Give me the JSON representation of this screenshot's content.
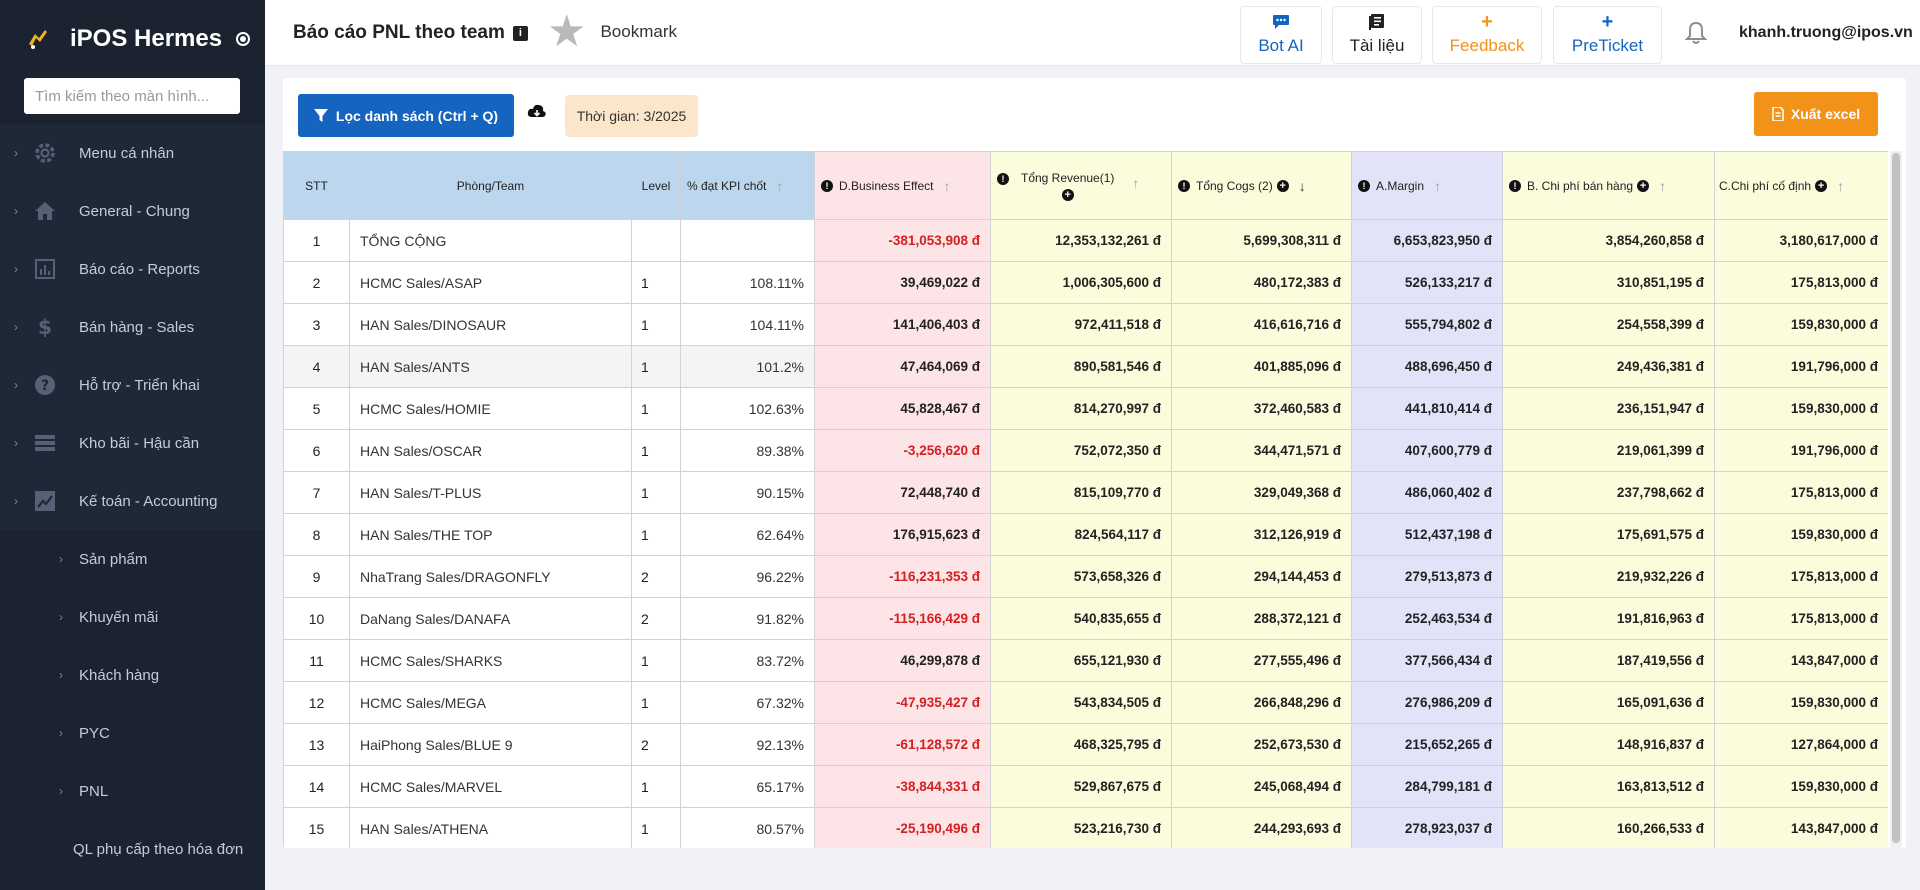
{
  "sidebar": {
    "app_name": "iPOS Hermes",
    "search_placeholder": "Tìm kiếm theo màn hình...",
    "menu": [
      {
        "label": "Menu cá nhân",
        "icon": "gear-icon"
      },
      {
        "label": "General - Chung",
        "icon": "home-icon"
      },
      {
        "label": "Báo cáo - Reports",
        "icon": "bar-chart-icon"
      },
      {
        "label": "Bán hàng - Sales",
        "icon": "dollar-icon"
      },
      {
        "label": "Hỗ trợ - Triển khai",
        "icon": "question-icon"
      },
      {
        "label": "Kho bãi - Hậu cần",
        "icon": "server-icon"
      },
      {
        "label": "Kế toán - Accounting",
        "icon": "chart-box-icon"
      }
    ],
    "submenu": [
      "Sản phẩm",
      "Khuyến mãi",
      "Khách hàng",
      "PYC",
      "PNL"
    ],
    "extra_item": "QL phụ cấp theo hóa đơn"
  },
  "header": {
    "title": "Báo cáo PNL theo team",
    "info_label": "i",
    "bookmark_label": "Bookmark",
    "buttons": {
      "bot_ai": "Bot AI",
      "tai_lieu": "Tài liệu",
      "feedback": "Feedback",
      "preticket": "PreTicket"
    },
    "user_email": "khanh.truong@ipos.vn"
  },
  "toolbar": {
    "filter_label": "Lọc danh sách (Ctrl + Q)",
    "time_label": "Thời gian: 3/2025",
    "export_label": "Xuất excel"
  },
  "table": {
    "headers": {
      "stt": "STT",
      "team": "Phòng/Team",
      "level": "Level",
      "kpi": "% đạt KPI chốt",
      "be": "D.Business Effect",
      "rev": "Tổng Revenue(1)",
      "cogs": "Tổng Cogs (2)",
      "am": "A.Margin",
      "bcp": "B. Chi phí bán hàng",
      "ccp": "C.Chi phí cố định"
    },
    "rows": [
      {
        "stt": "1",
        "team": "TỔNG CỘNG",
        "level": "",
        "kpi": "",
        "be": "-381,053,908 đ",
        "rev": "12,353,132,261 đ",
        "cogs": "5,699,308,311 đ",
        "am": "6,653,823,950 đ",
        "bcp": "3,854,260,858 đ",
        "ccp": "3,180,617,000 đ",
        "neg": true
      },
      {
        "stt": "2",
        "team": "HCMC Sales/ASAP",
        "level": "1",
        "kpi": "108.11%",
        "be": "39,469,022 đ",
        "rev": "1,006,305,600 đ",
        "cogs": "480,172,383 đ",
        "am": "526,133,217 đ",
        "bcp": "310,851,195 đ",
        "ccp": "175,813,000 đ",
        "neg": false
      },
      {
        "stt": "3",
        "team": "HAN Sales/DINOSAUR",
        "level": "1",
        "kpi": "104.11%",
        "be": "141,406,403 đ",
        "rev": "972,411,518 đ",
        "cogs": "416,616,716 đ",
        "am": "555,794,802 đ",
        "bcp": "254,558,399 đ",
        "ccp": "159,830,000 đ",
        "neg": false
      },
      {
        "stt": "4",
        "team": "HAN Sales/ANTS",
        "level": "1",
        "kpi": "101.2%",
        "be": "47,464,069 đ",
        "rev": "890,581,546 đ",
        "cogs": "401,885,096 đ",
        "am": "488,696,450 đ",
        "bcp": "249,436,381 đ",
        "ccp": "191,796,000 đ",
        "neg": false
      },
      {
        "stt": "5",
        "team": "HCMC Sales/HOMIE",
        "level": "1",
        "kpi": "102.63%",
        "be": "45,828,467 đ",
        "rev": "814,270,997 đ",
        "cogs": "372,460,583 đ",
        "am": "441,810,414 đ",
        "bcp": "236,151,947 đ",
        "ccp": "159,830,000 đ",
        "neg": false
      },
      {
        "stt": "6",
        "team": "HAN Sales/OSCAR",
        "level": "1",
        "kpi": "89.38%",
        "be": "-3,256,620 đ",
        "rev": "752,072,350 đ",
        "cogs": "344,471,571 đ",
        "am": "407,600,779 đ",
        "bcp": "219,061,399 đ",
        "ccp": "191,796,000 đ",
        "neg": true
      },
      {
        "stt": "7",
        "team": "HAN Sales/T-PLUS",
        "level": "1",
        "kpi": "90.15%",
        "be": "72,448,740 đ",
        "rev": "815,109,770 đ",
        "cogs": "329,049,368 đ",
        "am": "486,060,402 đ",
        "bcp": "237,798,662 đ",
        "ccp": "175,813,000 đ",
        "neg": false
      },
      {
        "stt": "8",
        "team": "HAN Sales/THE TOP",
        "level": "1",
        "kpi": "62.64%",
        "be": "176,915,623 đ",
        "rev": "824,564,117 đ",
        "cogs": "312,126,919 đ",
        "am": "512,437,198 đ",
        "bcp": "175,691,575 đ",
        "ccp": "159,830,000 đ",
        "neg": false
      },
      {
        "stt": "9",
        "team": "NhaTrang Sales/DRAGONFLY",
        "level": "2",
        "kpi": "96.22%",
        "be": "-116,231,353 đ",
        "rev": "573,658,326 đ",
        "cogs": "294,144,453 đ",
        "am": "279,513,873 đ",
        "bcp": "219,932,226 đ",
        "ccp": "175,813,000 đ",
        "neg": true
      },
      {
        "stt": "10",
        "team": "DaNang Sales/DANAFA",
        "level": "2",
        "kpi": "91.82%",
        "be": "-115,166,429 đ",
        "rev": "540,835,655 đ",
        "cogs": "288,372,121 đ",
        "am": "252,463,534 đ",
        "bcp": "191,816,963 đ",
        "ccp": "175,813,000 đ",
        "neg": true
      },
      {
        "stt": "11",
        "team": "HCMC Sales/SHARKS",
        "level": "1",
        "kpi": "83.72%",
        "be": "46,299,878 đ",
        "rev": "655,121,930 đ",
        "cogs": "277,555,496 đ",
        "am": "377,566,434 đ",
        "bcp": "187,419,556 đ",
        "ccp": "143,847,000 đ",
        "neg": false
      },
      {
        "stt": "12",
        "team": "HCMC Sales/MEGA",
        "level": "1",
        "kpi": "67.32%",
        "be": "-47,935,427 đ",
        "rev": "543,834,505 đ",
        "cogs": "266,848,296 đ",
        "am": "276,986,209 đ",
        "bcp": "165,091,636 đ",
        "ccp": "159,830,000 đ",
        "neg": true
      },
      {
        "stt": "13",
        "team": "HaiPhong Sales/BLUE 9",
        "level": "2",
        "kpi": "92.13%",
        "be": "-61,128,572 đ",
        "rev": "468,325,795 đ",
        "cogs": "252,673,530 đ",
        "am": "215,652,265 đ",
        "bcp": "148,916,837 đ",
        "ccp": "127,864,000 đ",
        "neg": true
      },
      {
        "stt": "14",
        "team": "HCMC Sales/MARVEL",
        "level": "1",
        "kpi": "65.17%",
        "be": "-38,844,331 đ",
        "rev": "529,867,675 đ",
        "cogs": "245,068,494 đ",
        "am": "284,799,181 đ",
        "bcp": "163,813,512 đ",
        "ccp": "159,830,000 đ",
        "neg": true
      },
      {
        "stt": "15",
        "team": "HAN Sales/ATHENA",
        "level": "1",
        "kpi": "80.57%",
        "be": "-25,190,496 đ",
        "rev": "523,216,730 đ",
        "cogs": "244,293,693 đ",
        "am": "278,923,037 đ",
        "bcp": "160,266,533 đ",
        "ccp": "143,847,000 đ",
        "neg": true
      }
    ]
  },
  "colors": {
    "sidebar_bg": "#1b2330",
    "primary_blue": "#1565c0",
    "export_orange": "#f29218",
    "negative_red": "#d32020",
    "feedback_orange": "#f29218",
    "link_blue": "#1565c0"
  }
}
